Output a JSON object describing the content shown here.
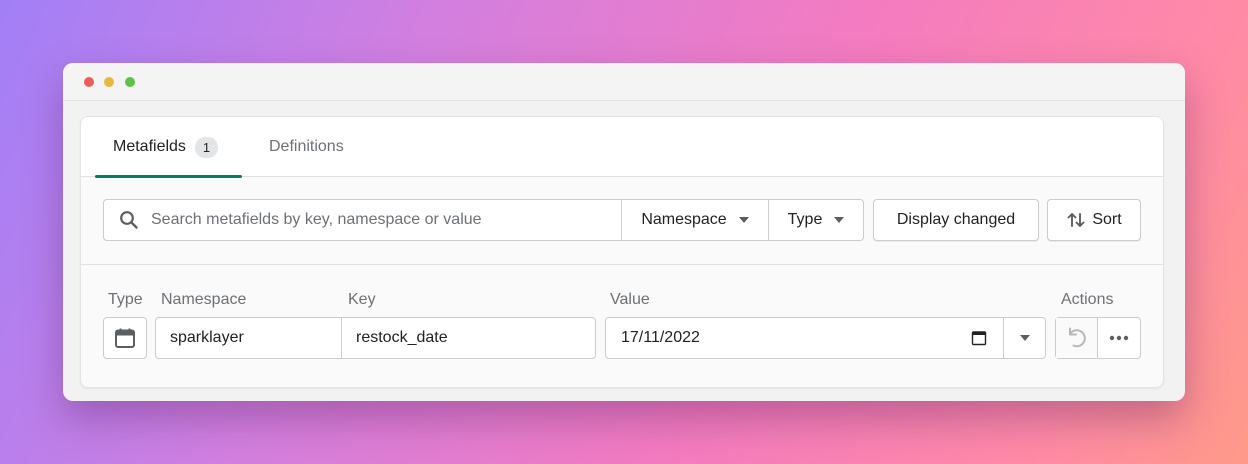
{
  "tabs": [
    {
      "label": "Metafields",
      "badge": "1"
    },
    {
      "label": "Definitions"
    }
  ],
  "search": {
    "placeholder": "Search metafields by key, namespace or value",
    "icon": "search-icon"
  },
  "filters": {
    "namespace_label": "Namespace",
    "type_label": "Type"
  },
  "buttons": {
    "display_changed": "Display changed",
    "sort": "Sort"
  },
  "columns": {
    "type": "Type",
    "namespace": "Namespace",
    "key": "Key",
    "value": "Value",
    "actions": "Actions"
  },
  "row": {
    "type_icon": "calendar-icon",
    "namespace": "sparklayer",
    "key": "restock_date",
    "value": "17/11/2022"
  },
  "colors": {
    "accent": "#008060",
    "border": "#c9cccf",
    "text": "#202223",
    "muted": "#6d7175"
  }
}
